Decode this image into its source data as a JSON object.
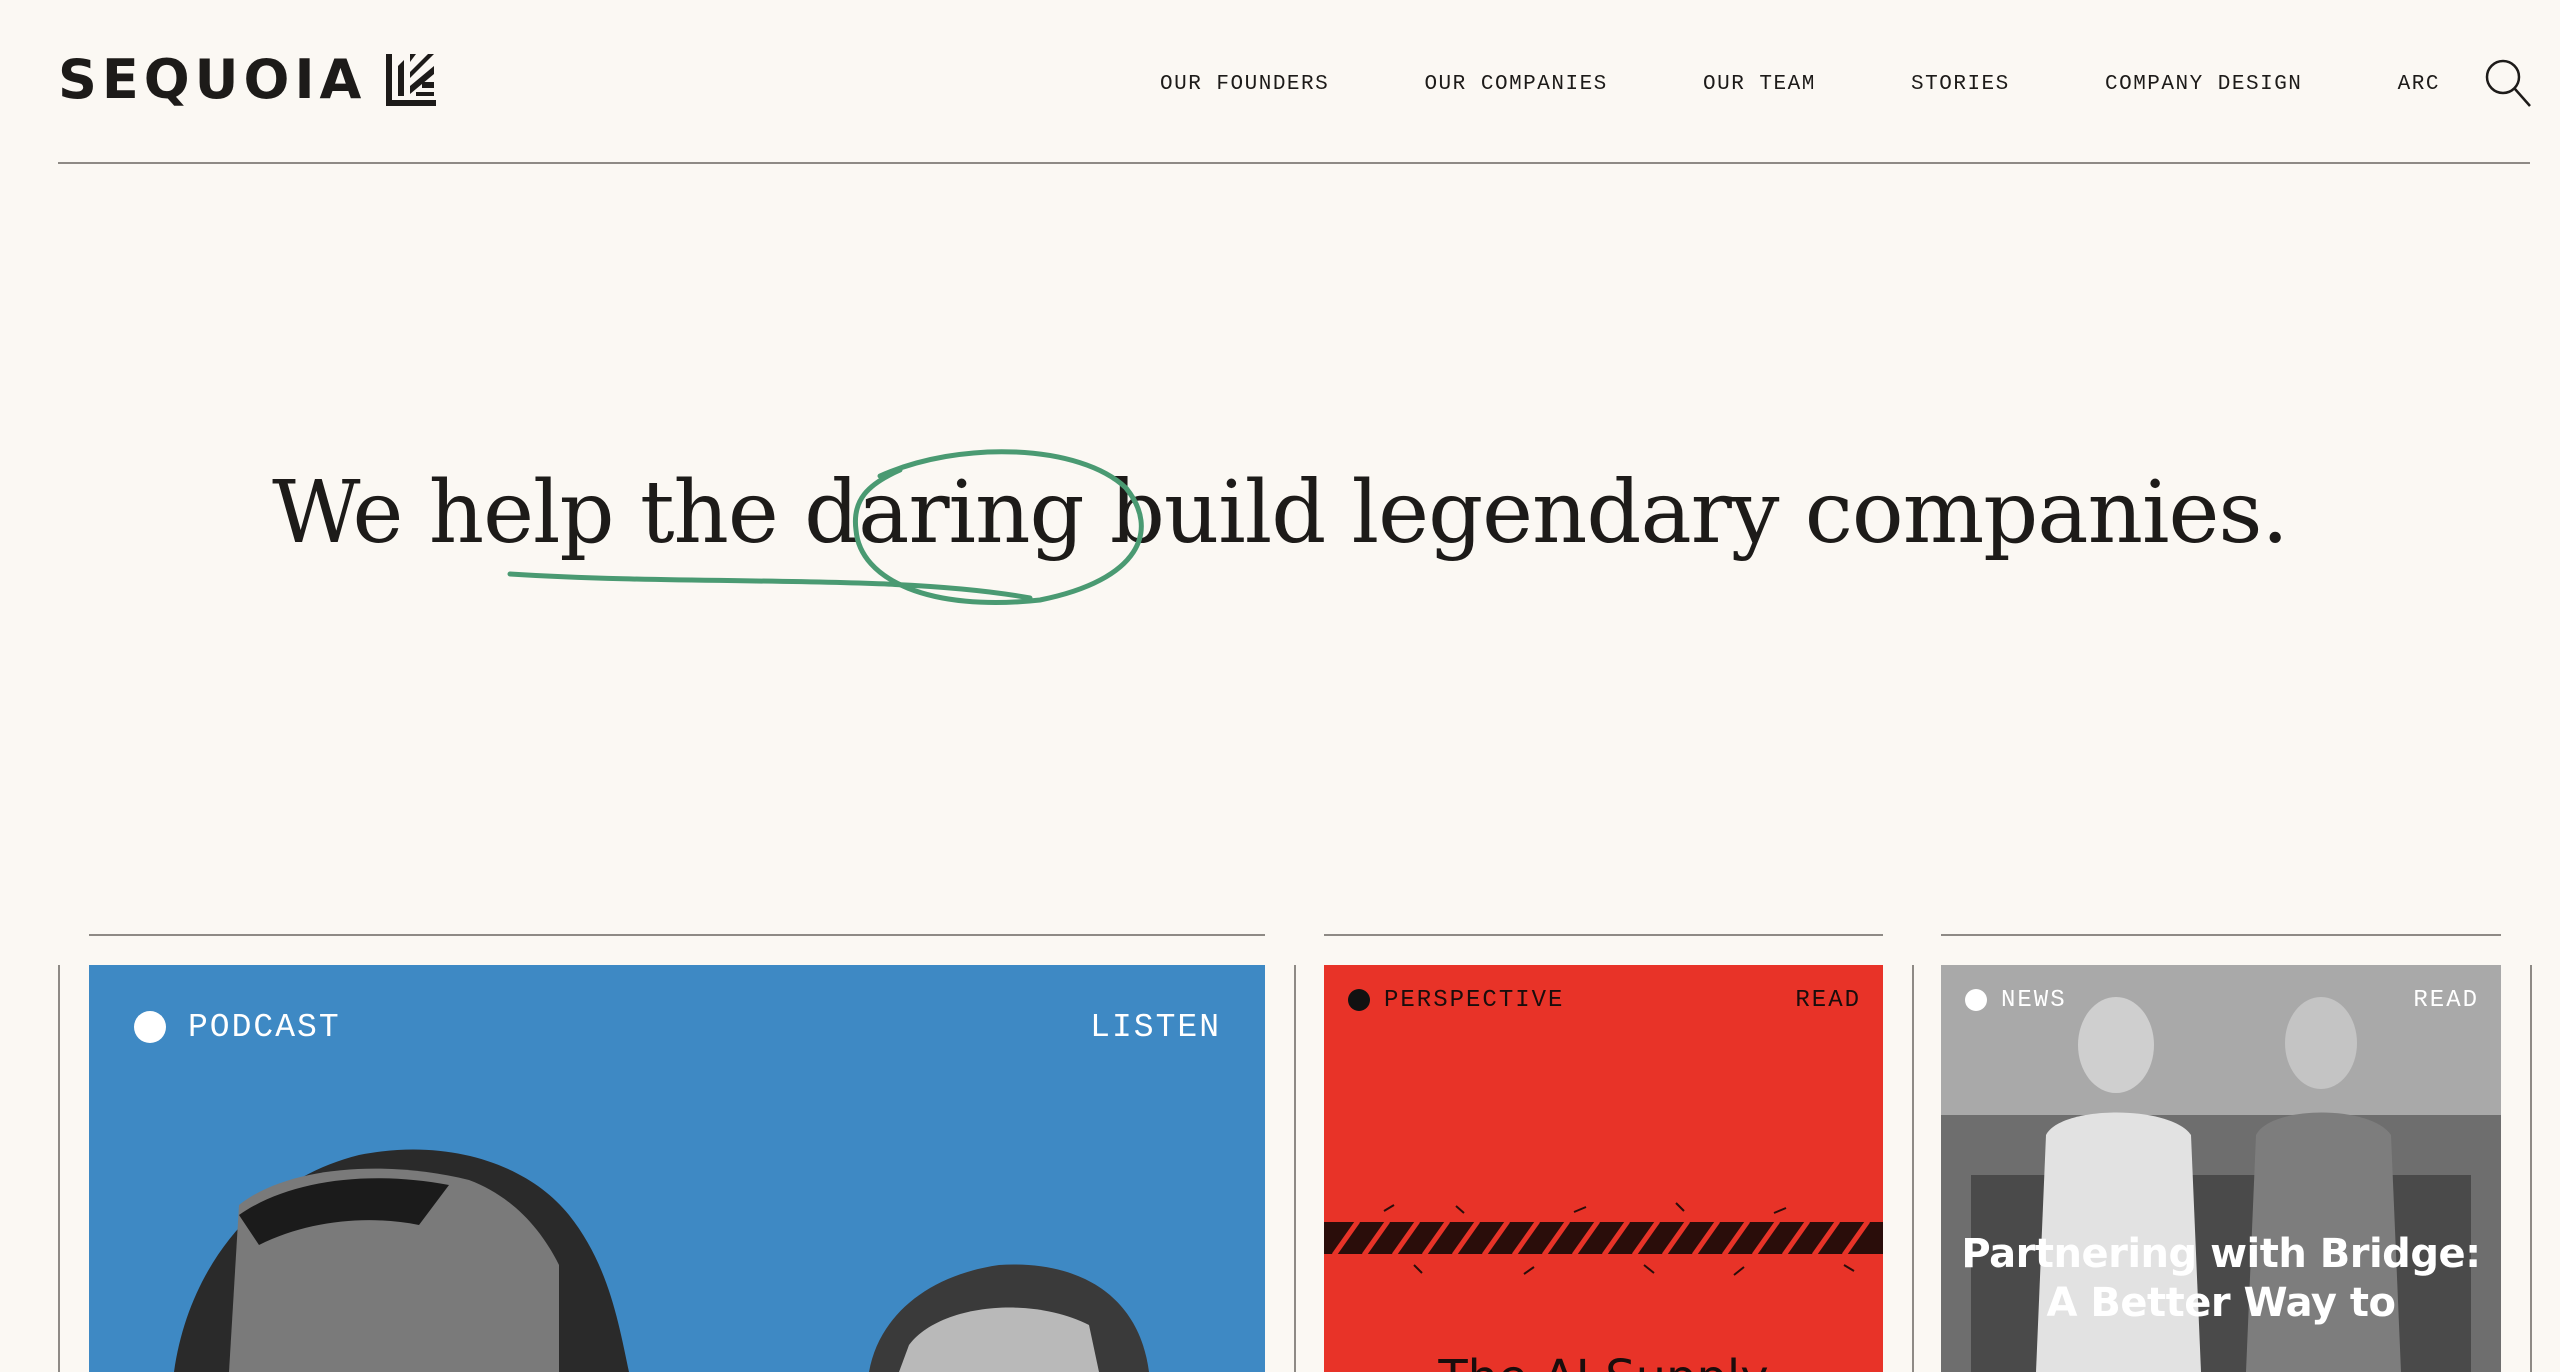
{
  "brand": {
    "name": "SEQUOIA"
  },
  "nav": {
    "items": [
      "OUR FOUNDERS",
      "OUR COMPANIES",
      "OUR TEAM",
      "STORIES",
      "COMPANY DESIGN",
      "ARC"
    ],
    "search_icon": "search-icon"
  },
  "hero": {
    "headline": "We help the daring build legendary companies.",
    "highlight_color": "#4a9a72"
  },
  "cards": [
    {
      "tag": "PODCAST",
      "action": "LISTEN",
      "background": "#3e89c4"
    },
    {
      "tag": "PERSPECTIVE",
      "action": "READ",
      "background": "#e83328",
      "title": "The AI Supply"
    },
    {
      "tag": "NEWS",
      "action": "READ",
      "background": "#8c8c8c",
      "title": "Partnering with Bridge: A Better Way to"
    }
  ],
  "colors": {
    "background": "#fbf8f3",
    "text": "#1d1b19",
    "rule": "#8e8a85"
  }
}
